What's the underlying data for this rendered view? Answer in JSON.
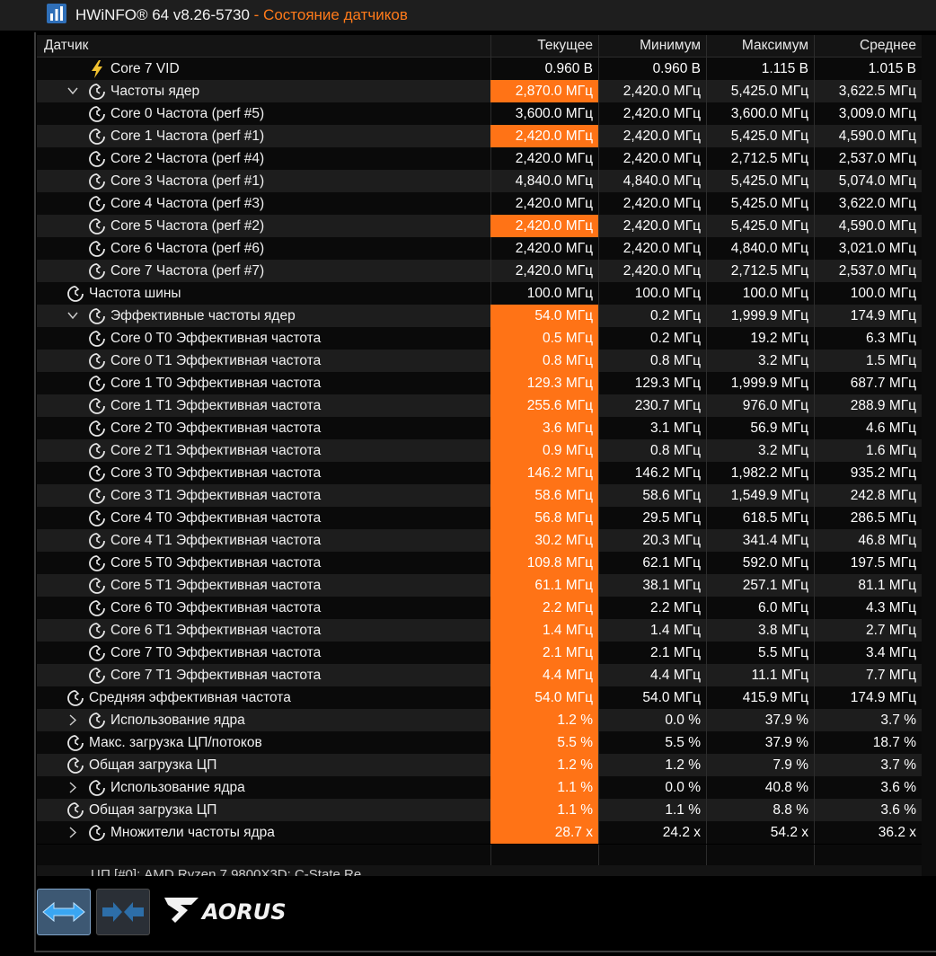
{
  "window": {
    "app": "HWiNFO® 64 v8.26-5730",
    "separator": " - ",
    "subtitle": "Состояние датчиков"
  },
  "columns": {
    "sensor": "Датчик",
    "current": "Текущее",
    "min": "Минимум",
    "max": "Максимум",
    "avg": "Среднее"
  },
  "rows": [
    {
      "label": "Core 7 VID",
      "icon": "voltage-bolt-icon",
      "level": 1,
      "expander": "",
      "cur": "0.960 В",
      "min": "0.960 В",
      "max": "1.115 В",
      "avg": "1.015 В",
      "hl": false
    },
    {
      "label": "Частоты ядер",
      "icon": "clock-icon",
      "level": 1,
      "expander": "collapse",
      "cur": "2,870.0 МГц",
      "min": "2,420.0 МГц",
      "max": "5,425.0 МГц",
      "avg": "3,622.5 МГц",
      "hl": true
    },
    {
      "label": "Core 0 Частота (perf #5)",
      "icon": "clock-icon",
      "level": 1,
      "expander": "",
      "cur": "3,600.0 МГц",
      "min": "2,420.0 МГц",
      "max": "3,600.0 МГц",
      "avg": "3,009.0 МГц",
      "hl": false
    },
    {
      "label": "Core 1 Частота (perf #1)",
      "icon": "clock-icon",
      "level": 1,
      "expander": "",
      "cur": "2,420.0 МГц",
      "min": "2,420.0 МГц",
      "max": "5,425.0 МГц",
      "avg": "4,590.0 МГц",
      "hl": true
    },
    {
      "label": "Core 2 Частота (perf #4)",
      "icon": "clock-icon",
      "level": 1,
      "expander": "",
      "cur": "2,420.0 МГц",
      "min": "2,420.0 МГц",
      "max": "2,712.5 МГц",
      "avg": "2,537.0 МГц",
      "hl": false
    },
    {
      "label": "Core 3 Частота (perf #1)",
      "icon": "clock-icon",
      "level": 1,
      "expander": "",
      "cur": "4,840.0 МГц",
      "min": "4,840.0 МГц",
      "max": "5,425.0 МГц",
      "avg": "5,074.0 МГц",
      "hl": false
    },
    {
      "label": "Core 4 Частота (perf #3)",
      "icon": "clock-icon",
      "level": 1,
      "expander": "",
      "cur": "2,420.0 МГц",
      "min": "2,420.0 МГц",
      "max": "5,425.0 МГц",
      "avg": "3,622.0 МГц",
      "hl": false
    },
    {
      "label": "Core 5 Частота (perf #2)",
      "icon": "clock-icon",
      "level": 1,
      "expander": "",
      "cur": "2,420.0 МГц",
      "min": "2,420.0 МГц",
      "max": "5,425.0 МГц",
      "avg": "4,590.0 МГц",
      "hl": true
    },
    {
      "label": "Core 6 Частота (perf #6)",
      "icon": "clock-icon",
      "level": 1,
      "expander": "",
      "cur": "2,420.0 МГц",
      "min": "2,420.0 МГц",
      "max": "4,840.0 МГц",
      "avg": "3,021.0 МГц",
      "hl": false
    },
    {
      "label": "Core 7 Частота (perf #7)",
      "icon": "clock-icon",
      "level": 1,
      "expander": "",
      "cur": "2,420.0 МГц",
      "min": "2,420.0 МГц",
      "max": "2,712.5 МГц",
      "avg": "2,537.0 МГц",
      "hl": false
    },
    {
      "label": "Частота шины",
      "icon": "clock-icon",
      "level": 0,
      "expander": "",
      "cur": "100.0 МГц",
      "min": "100.0 МГц",
      "max": "100.0 МГц",
      "avg": "100.0 МГц",
      "hl": false
    },
    {
      "label": "Эффективные частоты ядер",
      "icon": "clock-icon",
      "level": 1,
      "expander": "collapse",
      "cur": "54.0 МГц",
      "min": "0.2 МГц",
      "max": "1,999.9 МГц",
      "avg": "174.9 МГц",
      "hl": true
    },
    {
      "label": "Core 0 T0 Эффективная частота",
      "icon": "clock-icon",
      "level": 1,
      "expander": "",
      "cur": "0.5 МГц",
      "min": "0.2 МГц",
      "max": "19.2 МГц",
      "avg": "6.3 МГц",
      "hl": true
    },
    {
      "label": "Core 0 T1 Эффективная частота",
      "icon": "clock-icon",
      "level": 1,
      "expander": "",
      "cur": "0.8 МГц",
      "min": "0.8 МГц",
      "max": "3.2 МГц",
      "avg": "1.5 МГц",
      "hl": true
    },
    {
      "label": "Core 1 T0 Эффективная частота",
      "icon": "clock-icon",
      "level": 1,
      "expander": "",
      "cur": "129.3 МГц",
      "min": "129.3 МГц",
      "max": "1,999.9 МГц",
      "avg": "687.7 МГц",
      "hl": true
    },
    {
      "label": "Core 1 T1 Эффективная частота",
      "icon": "clock-icon",
      "level": 1,
      "expander": "",
      "cur": "255.6 МГц",
      "min": "230.7 МГц",
      "max": "976.0 МГц",
      "avg": "288.9 МГц",
      "hl": true
    },
    {
      "label": "Core 2 T0 Эффективная частота",
      "icon": "clock-icon",
      "level": 1,
      "expander": "",
      "cur": "3.6 МГц",
      "min": "3.1 МГц",
      "max": "56.9 МГц",
      "avg": "4.6 МГц",
      "hl": true
    },
    {
      "label": "Core 2 T1 Эффективная частота",
      "icon": "clock-icon",
      "level": 1,
      "expander": "",
      "cur": "0.9 МГц",
      "min": "0.8 МГц",
      "max": "3.2 МГц",
      "avg": "1.6 МГц",
      "hl": true
    },
    {
      "label": "Core 3 T0 Эффективная частота",
      "icon": "clock-icon",
      "level": 1,
      "expander": "",
      "cur": "146.2 МГц",
      "min": "146.2 МГц",
      "max": "1,982.2 МГц",
      "avg": "935.2 МГц",
      "hl": true
    },
    {
      "label": "Core 3 T1 Эффективная частота",
      "icon": "clock-icon",
      "level": 1,
      "expander": "",
      "cur": "58.6 МГц",
      "min": "58.6 МГц",
      "max": "1,549.9 МГц",
      "avg": "242.8 МГц",
      "hl": true
    },
    {
      "label": "Core 4 T0 Эффективная частота",
      "icon": "clock-icon",
      "level": 1,
      "expander": "",
      "cur": "56.8 МГц",
      "min": "29.5 МГц",
      "max": "618.5 МГц",
      "avg": "286.5 МГц",
      "hl": true
    },
    {
      "label": "Core 4 T1 Эффективная частота",
      "icon": "clock-icon",
      "level": 1,
      "expander": "",
      "cur": "30.2 МГц",
      "min": "20.3 МГц",
      "max": "341.4 МГц",
      "avg": "46.8 МГц",
      "hl": true
    },
    {
      "label": "Core 5 T0 Эффективная частота",
      "icon": "clock-icon",
      "level": 1,
      "expander": "",
      "cur": "109.8 МГц",
      "min": "62.1 МГц",
      "max": "592.0 МГц",
      "avg": "197.5 МГц",
      "hl": true
    },
    {
      "label": "Core 5 T1 Эффективная частота",
      "icon": "clock-icon",
      "level": 1,
      "expander": "",
      "cur": "61.1 МГц",
      "min": "38.1 МГц",
      "max": "257.1 МГц",
      "avg": "81.1 МГц",
      "hl": true
    },
    {
      "label": "Core 6 T0 Эффективная частота",
      "icon": "clock-icon",
      "level": 1,
      "expander": "",
      "cur": "2.2 МГц",
      "min": "2.2 МГц",
      "max": "6.0 МГц",
      "avg": "4.3 МГц",
      "hl": true
    },
    {
      "label": "Core 6 T1 Эффективная частота",
      "icon": "clock-icon",
      "level": 1,
      "expander": "",
      "cur": "1.4 МГц",
      "min": "1.4 МГц",
      "max": "3.8 МГц",
      "avg": "2.7 МГц",
      "hl": true
    },
    {
      "label": "Core 7 T0 Эффективная частота",
      "icon": "clock-icon",
      "level": 1,
      "expander": "",
      "cur": "2.1 МГц",
      "min": "2.1 МГц",
      "max": "5.5 МГц",
      "avg": "3.4 МГц",
      "hl": true
    },
    {
      "label": "Core 7 T1 Эффективная частота",
      "icon": "clock-icon",
      "level": 1,
      "expander": "",
      "cur": "4.4 МГц",
      "min": "4.4 МГц",
      "max": "11.1 МГц",
      "avg": "7.7 МГц",
      "hl": true
    },
    {
      "label": "Средняя эффективная частота",
      "icon": "clock-icon",
      "level": 0,
      "expander": "",
      "cur": "54.0 МГц",
      "min": "54.0 МГц",
      "max": "415.9 МГц",
      "avg": "174.9 МГц",
      "hl": true
    },
    {
      "label": "Использование ядра",
      "icon": "clock-icon",
      "level": 1,
      "expander": "expand",
      "cur": "1.2 %",
      "min": "0.0 %",
      "max": "37.9 %",
      "avg": "3.7 %",
      "hl": true
    },
    {
      "label": "Макс. загрузка ЦП/потоков",
      "icon": "clock-icon",
      "level": 0,
      "expander": "",
      "cur": "5.5 %",
      "min": "5.5 %",
      "max": "37.9 %",
      "avg": "18.7 %",
      "hl": true
    },
    {
      "label": "Общая загрузка ЦП",
      "icon": "clock-icon",
      "level": 0,
      "expander": "",
      "cur": "1.2 %",
      "min": "1.2 %",
      "max": "7.9 %",
      "avg": "3.7 %",
      "hl": true
    },
    {
      "label": "Использование ядра",
      "icon": "clock-icon",
      "level": 1,
      "expander": "expand",
      "cur": "1.1 %",
      "min": "0.0 %",
      "max": "40.8 %",
      "avg": "3.6 %",
      "hl": true
    },
    {
      "label": "Общая загрузка ЦП",
      "icon": "clock-icon",
      "level": 0,
      "expander": "",
      "cur": "1.1 %",
      "min": "1.1 %",
      "max": "8.8 %",
      "avg": "3.6 %",
      "hl": true
    },
    {
      "label": "Множители частоты ядра",
      "icon": "clock-icon",
      "level": 1,
      "expander": "expand",
      "cur": "28.7 x",
      "min": "24.2 x",
      "max": "54.2 x",
      "avg": "36.2 x",
      "hl": true
    }
  ],
  "next_group_partial": "ЦП [#0]: AMD Ryzen 7 9800X3D: C-State Re...",
  "toolbar": {
    "brand": "AORUS",
    "expand_icon": "expand-arrows-icon",
    "collapse_icon": "collapse-arrows-icon"
  },
  "colors": {
    "accent": "#ff7316",
    "title_accent": "#ff7a1a",
    "row_dark": "#0a0a0a",
    "row_alt": "#1d1d1d",
    "bolt": "#f2c230"
  }
}
